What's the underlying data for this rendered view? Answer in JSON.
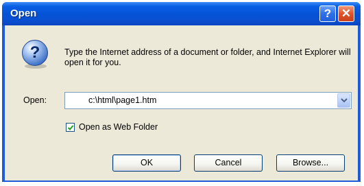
{
  "window": {
    "title": "Open",
    "help_glyph": "?",
    "close_glyph": "✕"
  },
  "dialog": {
    "icon": "question-icon",
    "message": "Type the Internet address of a document or folder, and Internet Explorer will open it for you.",
    "open_label": "Open:",
    "open_value": "c:\\html\\page1.htm",
    "checkbox_label": "Open as Web Folder",
    "checkbox_checked": true
  },
  "buttons": {
    "ok": "OK",
    "cancel": "Cancel",
    "browse": "Browse..."
  },
  "colors": {
    "titlebar": "#0553d6",
    "face": "#ece9d8",
    "close": "#e0522a"
  }
}
